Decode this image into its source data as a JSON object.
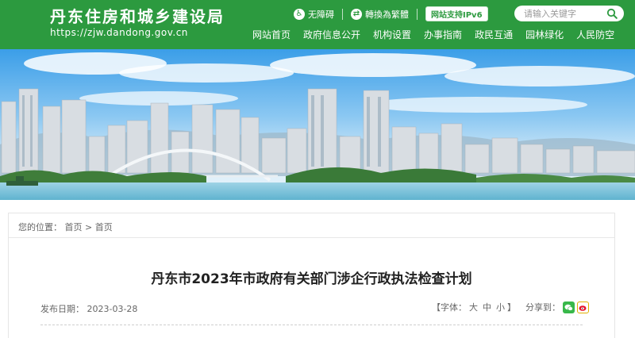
{
  "site": {
    "title": "丹东住房和城乡建设局",
    "url": "https://zjw.dandong.gov.cn"
  },
  "topbar": {
    "accessibility": "无障碍",
    "traditional": "轉換為繁體",
    "ipv6": "网站支持IPv6",
    "search_placeholder": "请输入关键字"
  },
  "nav": [
    "网站首页",
    "政府信息公开",
    "机构设置",
    "办事指南",
    "政民互通",
    "园林绿化",
    "人民防空"
  ],
  "breadcrumb": {
    "prefix": "您的位置：",
    "items": [
      "首页",
      "首页"
    ],
    "separator": ">"
  },
  "article": {
    "title": "丹东市2023年市政府有关部门涉企行政执法检查计划",
    "date_label": "发布日期：",
    "date": "2023-03-28",
    "font_label": "【字体：",
    "font_sizes": [
      "大",
      "中",
      "小"
    ],
    "font_close": "】",
    "share_label": "分享到："
  },
  "colors": {
    "brand": "#2c9a3f",
    "wechat": "#38b84a",
    "weibo": "#e6162d"
  }
}
